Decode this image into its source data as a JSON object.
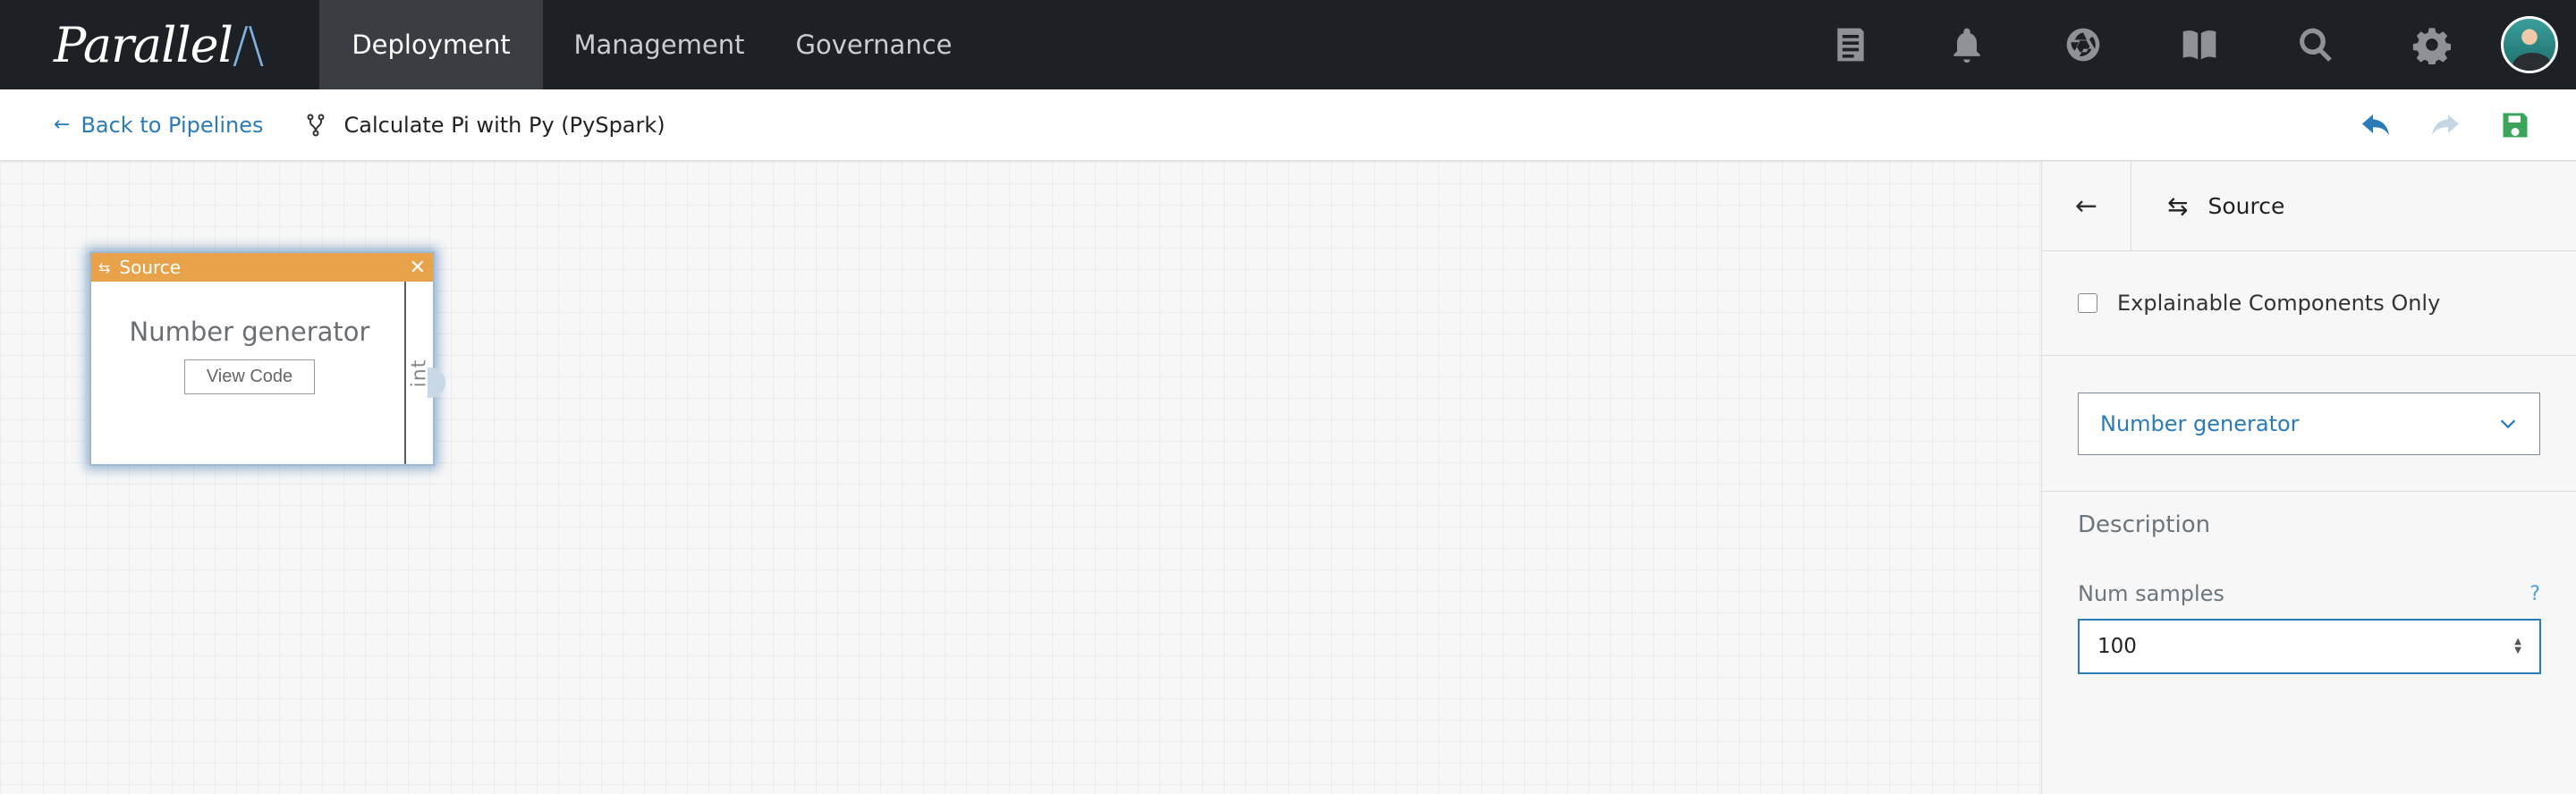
{
  "app": {
    "logo_text": "Parallel",
    "logo_mark": "/\\"
  },
  "nav": {
    "tabs": [
      {
        "label": "Deployment",
        "active": true
      },
      {
        "label": "Management",
        "active": false
      },
      {
        "label": "Governance",
        "active": false
      }
    ],
    "icons": [
      "document-list-icon",
      "bell-icon",
      "aperture-icon",
      "book-icon",
      "search-icon",
      "gear-icon",
      "user-avatar"
    ]
  },
  "subheader": {
    "back_label": "Back to Pipelines",
    "pipeline_name": "Calculate Pi with Py (PySpark)",
    "actions": [
      "undo-icon",
      "redo-icon",
      "save-icon"
    ]
  },
  "canvas": {
    "node": {
      "header_label": "Source",
      "title": "Number generator",
      "button_label": "View Code",
      "port_label": "int"
    }
  },
  "panel": {
    "title": "Source",
    "explainable_label": "Explainable Components Only",
    "explainable_checked": false,
    "selected_component": "Number generator",
    "description_label": "Description",
    "num_samples_label": "Num samples",
    "help_text": "?",
    "num_samples_value": "100"
  },
  "colors": {
    "nav_bg": "#1d2024",
    "accent_blue": "#2b7bb9",
    "node_header": "#e8a24a",
    "save_green": "#3aa55a"
  }
}
